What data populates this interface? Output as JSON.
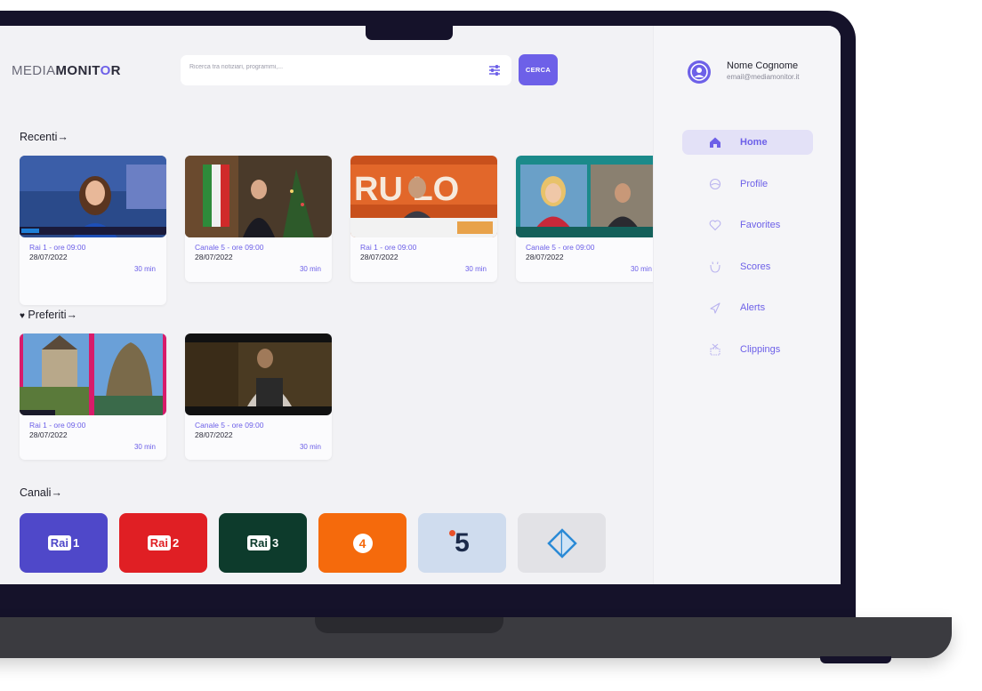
{
  "app": {
    "logo_light": "MEDIA",
    "logo_bold": "MONIT",
    "logo_o": "O",
    "logo_end": "R"
  },
  "search": {
    "placeholder": "Ricerca tra notiziari, programmi,...",
    "button_label": "CERCA"
  },
  "sections": {
    "recent": "Recenti",
    "favorites": "Preferiti",
    "channels": "Canali",
    "arrow": "→"
  },
  "recent_cards": [
    {
      "channel": "Rai 1 - ore 09:00",
      "date": "28/07/2022",
      "duration": "30 min"
    },
    {
      "channel": "Canale 5 - ore 09:00",
      "date": "28/07/2022",
      "duration": "30 min"
    },
    {
      "channel": "Rai 1 - ore 09:00",
      "date": "28/07/2022",
      "duration": "30 min"
    },
    {
      "channel": "Canale 5 - ore 09:00",
      "date": "28/07/2022",
      "duration": "30 min"
    }
  ],
  "favorite_cards": [
    {
      "channel": "Rai 1 - ore 09:00",
      "date": "28/07/2022",
      "duration": "30 min"
    },
    {
      "channel": "Canale 5 - ore 09:00",
      "date": "28/07/2022",
      "duration": "30 min"
    }
  ],
  "channels": [
    {
      "label": "Rai",
      "number": "1",
      "color": "#4f48c9"
    },
    {
      "label": "Rai",
      "number": "2",
      "color": "#e01f24"
    },
    {
      "label": "Rai",
      "number": "3",
      "color": "#0d3b2c"
    },
    {
      "label": "4",
      "color": "#f56a0c"
    },
    {
      "label": "5",
      "color": "#cfdcee"
    },
    {
      "label": "",
      "color": "#e2e2e6"
    }
  ],
  "user": {
    "name": "Nome Cognome",
    "email": "email@mediamonitor.it"
  },
  "nav": [
    {
      "label": "Home",
      "icon": "home-icon",
      "active": true
    },
    {
      "label": "Profile",
      "icon": "profile-icon"
    },
    {
      "label": "Favorites",
      "icon": "heart-icon"
    },
    {
      "label": "Scores",
      "icon": "scores-icon"
    },
    {
      "label": "Alerts",
      "icon": "alert-icon"
    },
    {
      "label": "Clippings",
      "icon": "clipping-icon"
    }
  ],
  "colors": {
    "accent": "#6d60e8",
    "frame": "#15122a"
  }
}
